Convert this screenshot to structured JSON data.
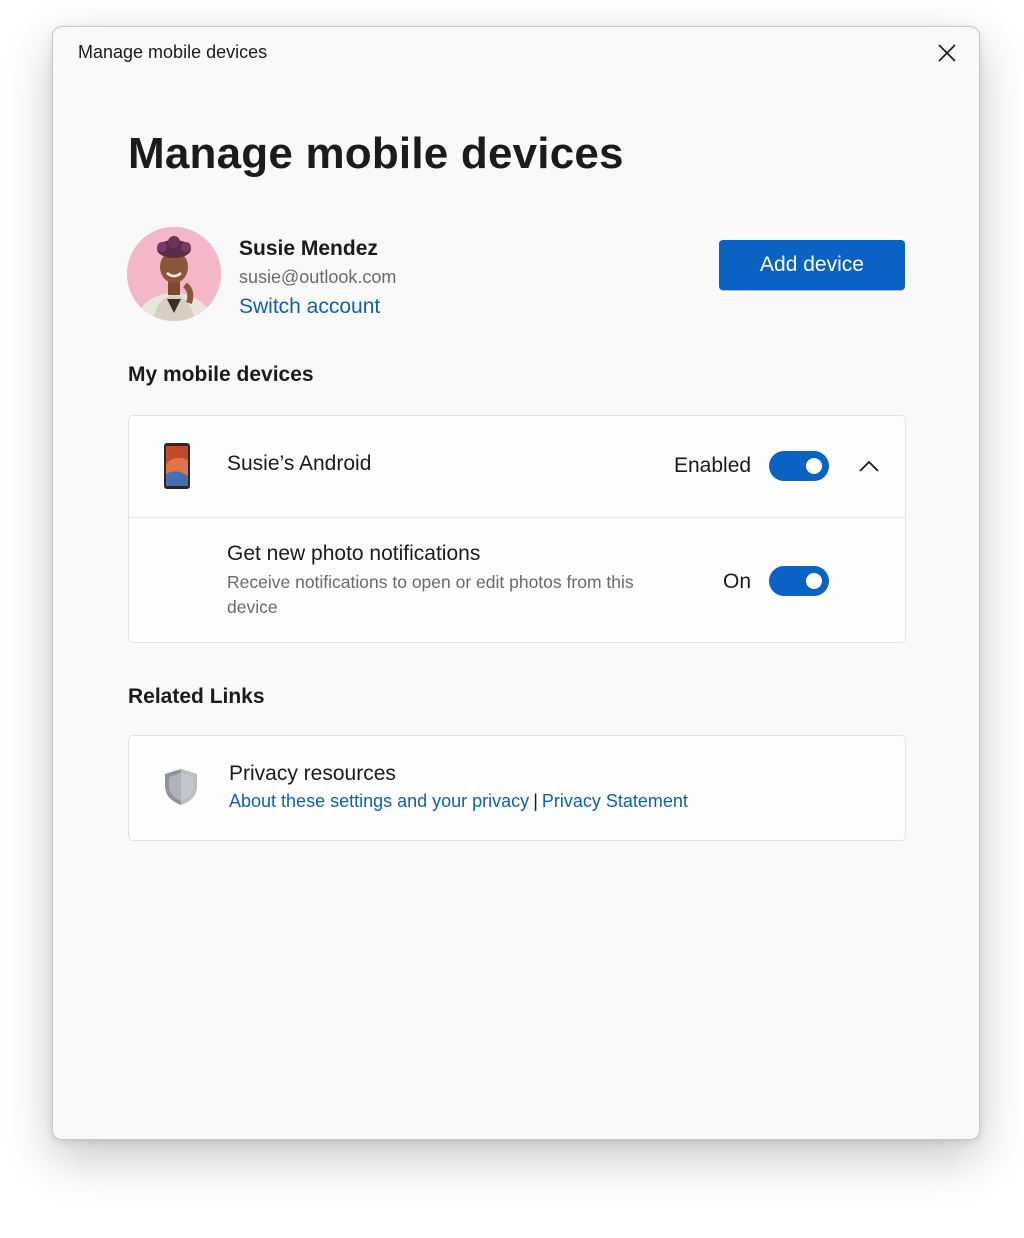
{
  "window": {
    "title": "Manage mobile devices",
    "close_icon": "close-icon"
  },
  "page": {
    "heading": "Manage mobile devices"
  },
  "account": {
    "name": "Susie Mendez",
    "email": "susie@outlook.com",
    "switch_label": "Switch account",
    "add_device_label": "Add device"
  },
  "devices_section": {
    "label": "My mobile devices",
    "device": {
      "name": "Susie’s Android",
      "icon": "phone-icon",
      "status_label": "Enabled",
      "enabled": true,
      "expanded": true
    },
    "setting": {
      "title": "Get new photo notifications",
      "description": "Receive notifications to open or edit photos from this device",
      "state_label": "On",
      "on": true
    }
  },
  "related_section": {
    "label": "Related Links",
    "privacy": {
      "icon": "shield-icon",
      "title": "Privacy resources",
      "link1": "About these settings and your privacy",
      "separator": "|",
      "link2": "Privacy Statement"
    }
  },
  "colors": {
    "accent": "#0a62c2",
    "link": "#0f5fb8",
    "background": "#f9f9f9"
  }
}
